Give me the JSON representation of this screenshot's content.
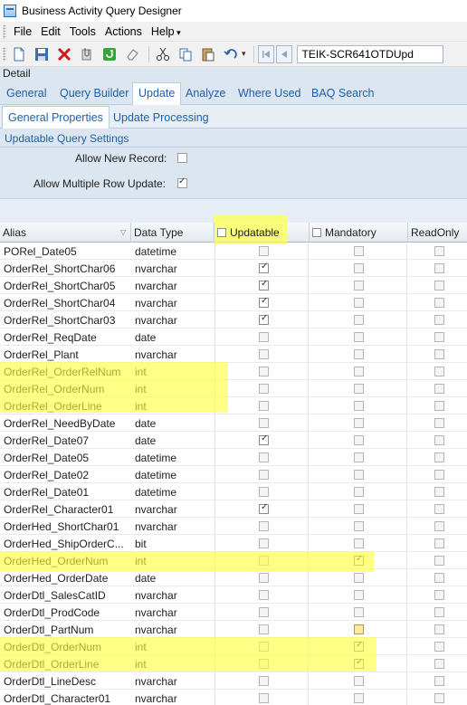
{
  "window": {
    "title": "Business Activity Query Designer"
  },
  "menu": [
    "File",
    "Edit",
    "Tools",
    "Actions",
    "Help"
  ],
  "toolbar": {
    "icons": [
      "new-icon",
      "save-icon",
      "delete-icon",
      "attach-icon",
      "refresh-icon",
      "clear-icon",
      "cut-icon",
      "copy-icon",
      "paste-icon",
      "undo-icon"
    ],
    "key_value": "TEIK-SCR641OTDUpd"
  },
  "detail_label": "Detail",
  "tabs_main": [
    "General",
    "Query Builder",
    "Update",
    "Analyze",
    "Where Used",
    "BAQ Search"
  ],
  "tabs_sub": [
    "General Properties",
    "Update",
    "Processing"
  ],
  "settings": {
    "title": "Updatable Query Settings",
    "allow_new_record_label": "Allow New Record:",
    "allow_new_record": false,
    "allow_multi_label": "Allow Multiple Row Update:",
    "allow_multi": true
  },
  "grid": {
    "headers": {
      "alias": "Alias",
      "data_type": "Data Type",
      "updatable": "Updatable",
      "mandatory": "Mandatory",
      "readonly": "ReadOnly"
    },
    "rows": [
      {
        "alias": "PORel_Date05",
        "type": "datetime",
        "upd": false,
        "man": false,
        "ro": false
      },
      {
        "alias": "OrderRel_ShortChar06",
        "type": "nvarchar",
        "upd": true,
        "man": false,
        "ro": false
      },
      {
        "alias": "OrderRel_ShortChar05",
        "type": "nvarchar",
        "upd": true,
        "man": false,
        "ro": false
      },
      {
        "alias": "OrderRel_ShortChar04",
        "type": "nvarchar",
        "upd": true,
        "man": false,
        "ro": false
      },
      {
        "alias": "OrderRel_ShortChar03",
        "type": "nvarchar",
        "upd": true,
        "man": false,
        "ro": false
      },
      {
        "alias": "OrderRel_ReqDate",
        "type": "date",
        "upd": false,
        "man": false,
        "ro": false
      },
      {
        "alias": "OrderRel_Plant",
        "type": "nvarchar",
        "upd": false,
        "man": false,
        "ro": false
      },
      {
        "alias": "OrderRel_OrderRelNum",
        "type": "int",
        "upd": false,
        "man": false,
        "ro": false
      },
      {
        "alias": "OrderRel_OrderNum",
        "type": "int",
        "upd": false,
        "man": false,
        "ro": false
      },
      {
        "alias": "OrderRel_OrderLine",
        "type": "int",
        "upd": false,
        "man": false,
        "ro": false
      },
      {
        "alias": "OrderRel_NeedByDate",
        "type": "date",
        "upd": false,
        "man": false,
        "ro": false
      },
      {
        "alias": "OrderRel_Date07",
        "type": "date",
        "upd": true,
        "man": false,
        "ro": false
      },
      {
        "alias": "OrderRel_Date05",
        "type": "datetime",
        "upd": false,
        "man": false,
        "ro": false
      },
      {
        "alias": "OrderRel_Date02",
        "type": "datetime",
        "upd": false,
        "man": false,
        "ro": false
      },
      {
        "alias": "OrderRel_Date01",
        "type": "datetime",
        "upd": false,
        "man": false,
        "ro": false
      },
      {
        "alias": "OrderRel_Character01",
        "type": "nvarchar",
        "upd": true,
        "man": false,
        "ro": false
      },
      {
        "alias": "OrderHed_ShortChar01",
        "type": "nvarchar",
        "upd": false,
        "man": false,
        "ro": false
      },
      {
        "alias": "OrderHed_ShipOrderC...",
        "type": "bit",
        "upd": false,
        "man": false,
        "ro": false
      },
      {
        "alias": "OrderHed_OrderNum",
        "type": "int",
        "upd": false,
        "man": true,
        "ro": false
      },
      {
        "alias": "OrderHed_OrderDate",
        "type": "date",
        "upd": false,
        "man": false,
        "ro": false
      },
      {
        "alias": "OrderDtl_SalesCatID",
        "type": "nvarchar",
        "upd": false,
        "man": false,
        "ro": false
      },
      {
        "alias": "OrderDtl_ProdCode",
        "type": "nvarchar",
        "upd": false,
        "man": false,
        "ro": false
      },
      {
        "alias": "OrderDtl_PartNum",
        "type": "nvarchar",
        "upd": false,
        "man": false,
        "ro": false
      },
      {
        "alias": "OrderDtl_OrderNum",
        "type": "int",
        "upd": false,
        "man": true,
        "ro": false
      },
      {
        "alias": "OrderDtl_OrderLine",
        "type": "int",
        "upd": false,
        "man": true,
        "ro": false
      },
      {
        "alias": "OrderDtl_LineDesc",
        "type": "nvarchar",
        "upd": false,
        "man": false,
        "ro": false
      },
      {
        "alias": "OrderDtl_Character01",
        "type": "nvarchar",
        "upd": false,
        "man": false,
        "ro": false
      }
    ]
  },
  "colors": {
    "accent": "#1f5fa8",
    "highlight": "#ffff3c",
    "panel": "#dce6f1"
  }
}
